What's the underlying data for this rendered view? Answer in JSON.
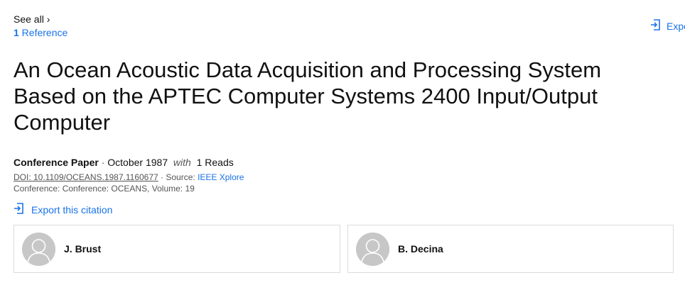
{
  "header": {
    "see_all": "See all ›",
    "reference_count": "1",
    "reference_label": " Reference",
    "export_top": "Expo"
  },
  "paper": {
    "title": "An Ocean Acoustic Data Acquisition and Processing System Based on the APTEC Computer Systems 2400 Input/Output Computer",
    "type": "Conference Paper",
    "date": "October 1987",
    "with": "with",
    "reads": "1 Reads",
    "doi": "DOI: 10.1109/OCEANS.1987.1160677",
    "source_label": " · Source: ",
    "source": "IEEE Xplore",
    "conference": "Conference: Conference: OCEANS, Volume: 19"
  },
  "actions": {
    "export_citation": "Export this citation"
  },
  "authors": [
    {
      "name": "J. Brust"
    },
    {
      "name": "B. Decina"
    }
  ],
  "colors": {
    "link": "#1a73e8",
    "avatar": "#c7c7c7",
    "card_border": "#dcdcdc"
  }
}
